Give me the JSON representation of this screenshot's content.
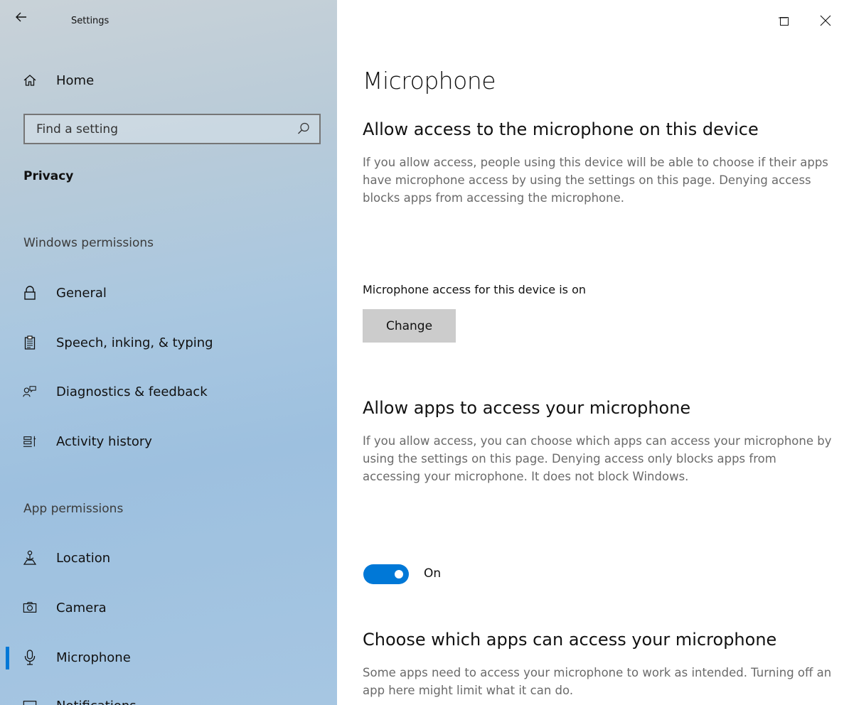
{
  "window": {
    "app_title": "Settings"
  },
  "sidebar": {
    "home_label": "Home",
    "search_placeholder": "Find a setting",
    "category": "Privacy",
    "sections": {
      "windows_permissions": "Windows permissions",
      "app_permissions": "App permissions"
    },
    "windows_items": [
      {
        "label": "General",
        "icon": "lock-icon"
      },
      {
        "label": "Speech, inking, & typing",
        "icon": "clipboard-icon"
      },
      {
        "label": "Diagnostics & feedback",
        "icon": "feedback-icon"
      },
      {
        "label": "Activity history",
        "icon": "activity-icon"
      }
    ],
    "app_items": [
      {
        "label": "Location",
        "icon": "location-icon"
      },
      {
        "label": "Camera",
        "icon": "camera-icon"
      },
      {
        "label": "Microphone",
        "icon": "microphone-icon",
        "selected": true
      },
      {
        "label": "Notifications",
        "icon": "notifications-icon"
      }
    ],
    "accent_color": "#0078d7"
  },
  "main": {
    "title": "Microphone",
    "device_section": {
      "heading": "Allow access to the microphone on this device",
      "description": "If you allow access, people using this device will be able to choose if their apps have microphone access by using the settings on this page. Denying access blocks apps from accessing the microphone.",
      "status": "Microphone access for this device is on",
      "button_label": "Change"
    },
    "apps_section": {
      "heading": "Allow apps to access your microphone",
      "description": "If you allow access, you can choose which apps can access your microphone by using the settings on this page. Denying access only blocks apps from accessing your microphone. It does not block Windows.",
      "toggle_state": "On"
    },
    "choose_section": {
      "heading": "Choose which apps can access your microphone",
      "description": "Some apps need to access your microphone to work as intended. Turning off an app here might limit what it can do."
    }
  }
}
